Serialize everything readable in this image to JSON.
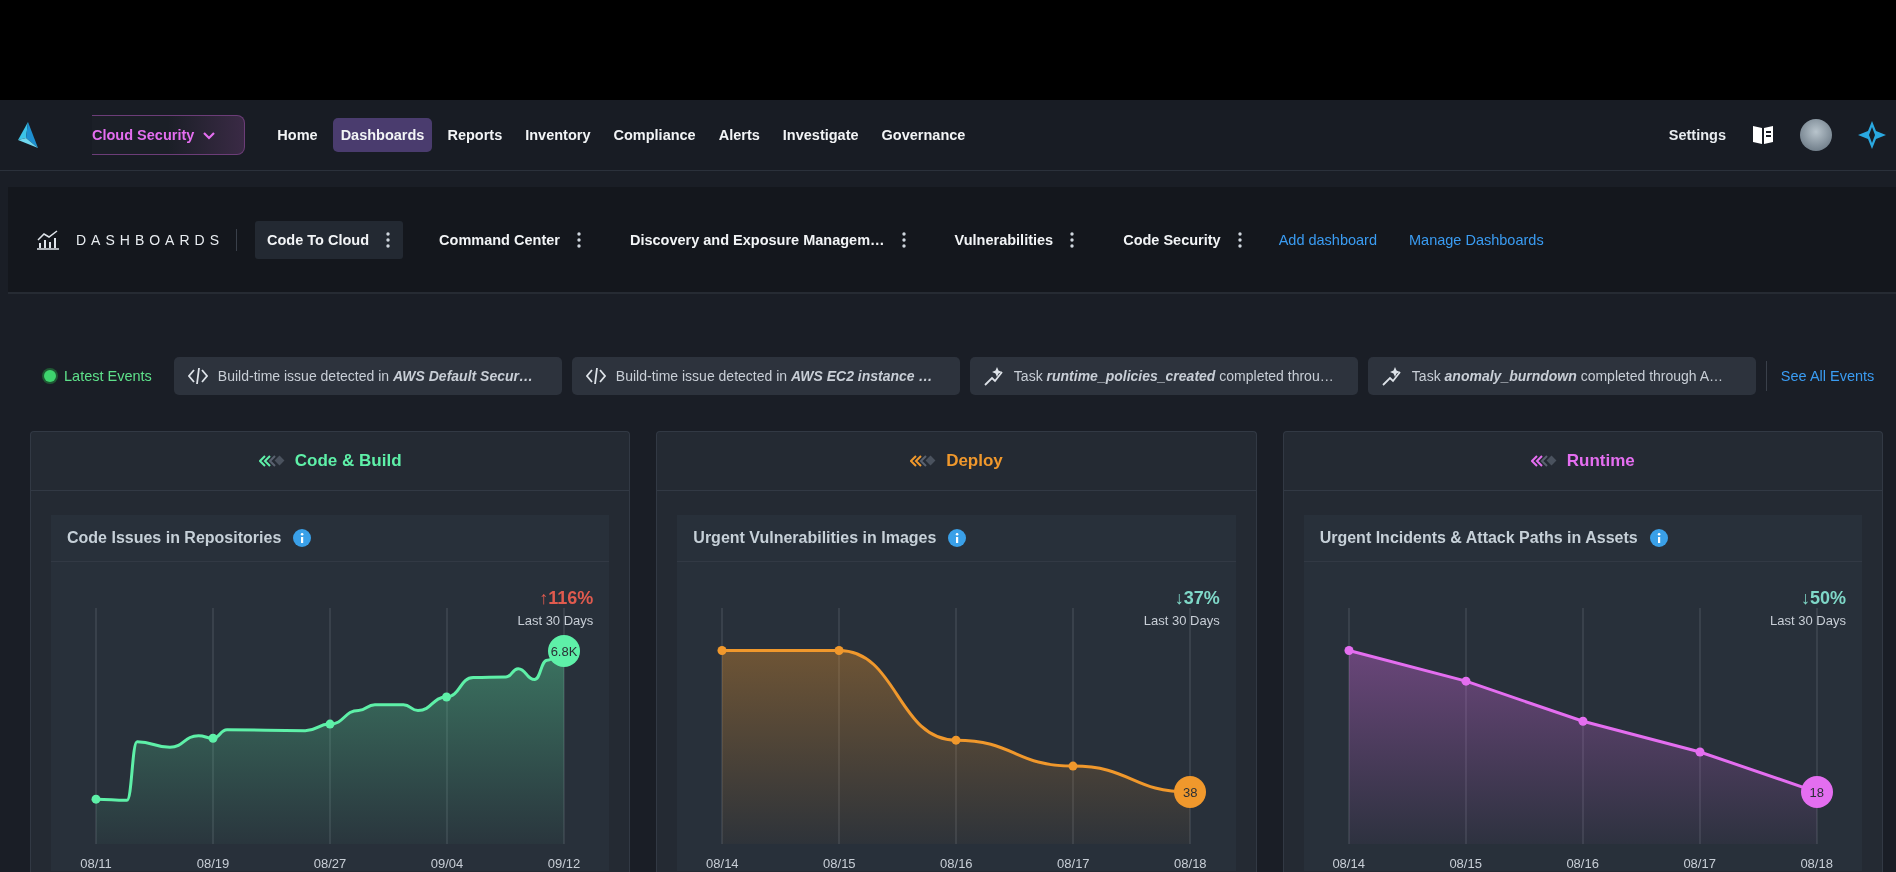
{
  "nav": {
    "product": "Cloud Security",
    "items": [
      {
        "label": "Home",
        "selected": false
      },
      {
        "label": "Dashboards",
        "selected": true
      },
      {
        "label": "Reports",
        "selected": false
      },
      {
        "label": "Inventory",
        "selected": false
      },
      {
        "label": "Compliance",
        "selected": false
      },
      {
        "label": "Alerts",
        "selected": false
      },
      {
        "label": "Investigate",
        "selected": false
      },
      {
        "label": "Governance",
        "selected": false
      }
    ],
    "settings": "Settings"
  },
  "dashboards": {
    "title": "DASHBOARDS",
    "tabs": [
      {
        "label": "Code To Cloud",
        "selected": true
      },
      {
        "label": "Command Center",
        "selected": false
      },
      {
        "label": "Discovery and Exposure Managem…",
        "selected": false
      },
      {
        "label": "Vulnerabilities",
        "selected": false
      },
      {
        "label": "Code Security",
        "selected": false
      }
    ],
    "links": [
      "Add dashboard",
      "Manage Dashboards"
    ]
  },
  "events": {
    "label": "Latest Events",
    "items": [
      {
        "kind": "code",
        "text": "Build-time issue detected in **AWS Default Secur…**"
      },
      {
        "kind": "code",
        "text": "Build-time issue detected in **AWS EC2 instance …**"
      },
      {
        "kind": "task",
        "text": "Task **runtime_policies_created** completed throu…"
      },
      {
        "kind": "task",
        "text": "Task **anomaly_burndown** completed through A…"
      }
    ],
    "see_all": "See All Events"
  },
  "stages": [
    {
      "title": "Code & Build",
      "color": "#5ef0a8",
      "widget": {
        "title": "Code Issues in Repositories",
        "trend": {
          "arrow": "↑",
          "value": "116%",
          "color": "#e05a4e"
        },
        "period": "Last 30 Days",
        "badge": "6.8K",
        "x_labels": [
          "08/11",
          "08/19",
          "08/27",
          "09/04",
          "09/12"
        ]
      }
    },
    {
      "title": "Deploy",
      "color": "#f0982c",
      "widget": {
        "title": "Urgent Vulnerabilities in Images",
        "trend": {
          "arrow": "↓",
          "value": "37%",
          "color": "#7fd8c8"
        },
        "period": "Last 30 Days",
        "badge": "38",
        "x_labels": [
          "08/14",
          "08/15",
          "08/16",
          "08/17",
          "08/18"
        ]
      }
    },
    {
      "title": "Runtime",
      "color": "#e46ef0",
      "widget": {
        "title": "Urgent Incidents & Attack Paths in Assets",
        "trend": {
          "arrow": "↓",
          "value": "50%",
          "color": "#7fd8c8"
        },
        "period": "Last 30 Days",
        "badge": "18",
        "x_labels": [
          "08/14",
          "08/15",
          "08/16",
          "08/17",
          "08/18"
        ]
      }
    }
  ]
}
